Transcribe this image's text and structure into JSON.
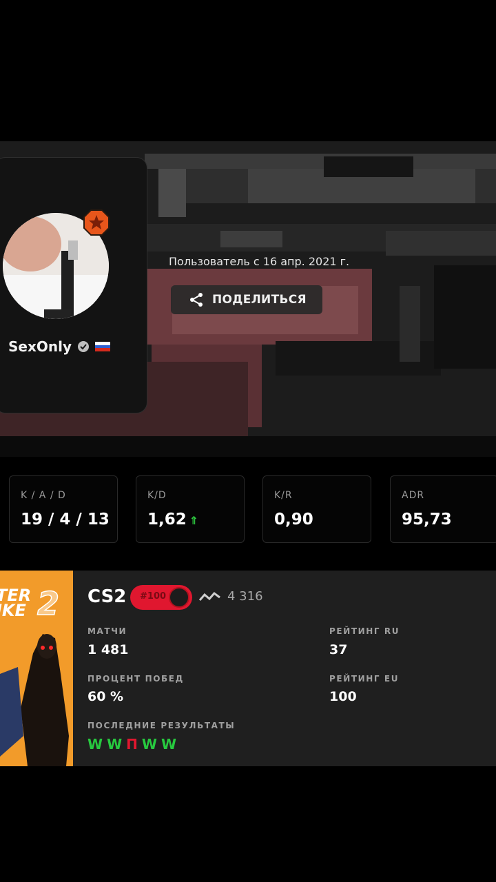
{
  "profile": {
    "username": "SexOnly",
    "verified_icon": "verified-icon",
    "country_flag": "ru-flag-icon",
    "rank_icon": "star-rank-icon",
    "member_since": "Пользователь с 16 апр. 2021 г.",
    "share_label": "ПОДЕЛИТЬСЯ"
  },
  "stats": [
    {
      "label": "K / A / D",
      "value": "19 / 4 / 13"
    },
    {
      "label": "K/D",
      "value": "1,62",
      "trend": "up"
    },
    {
      "label": "K/R",
      "value": "0,90"
    },
    {
      "label": "ADR",
      "value": "95,73"
    }
  ],
  "game": {
    "title": "CS2",
    "art_text_top": "TER",
    "art_text_bottom": "IKE",
    "art_number": "2",
    "elo_badge": "#100",
    "elo": "4 316",
    "matches_label": "МАТЧИ",
    "matches": "1 481",
    "rating_ru_label": "РЕЙТИНГ RU",
    "rating_ru": "37",
    "winrate_label": "ПРОЦЕНТ ПОБЕД",
    "winrate": "60 %",
    "rating_eu_label": "РЕЙТИНГ EU",
    "rating_eu": "100",
    "recent_label": "ПОСЛЕДНИЕ РЕЗУЛЬТАТЫ",
    "recent": [
      "W",
      "W",
      "П",
      "W",
      "W"
    ]
  },
  "colors": {
    "accent_red": "#e0172f",
    "win_green": "#27c93f",
    "rank_orange": "#e8561b"
  }
}
